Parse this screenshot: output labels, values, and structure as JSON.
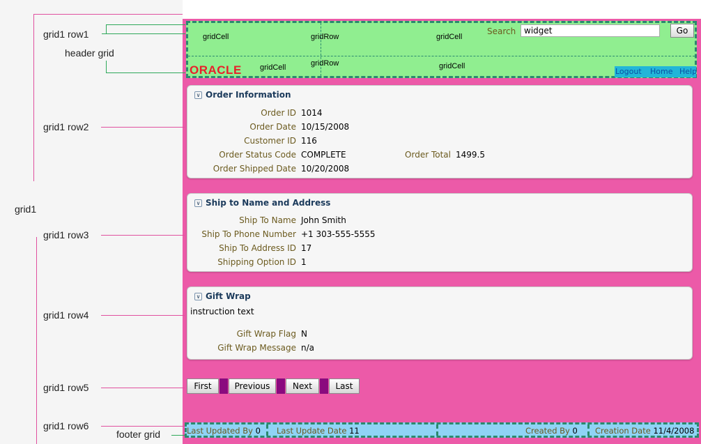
{
  "annotations": {
    "grid1_row1": "grid1 row1",
    "header_grid": "header grid",
    "grid1_row2": "grid1 row2",
    "grid1": "grid1",
    "grid1_row3": "grid1 row3",
    "grid1_row4": "grid1 row4",
    "grid1_row5": "grid1 row5",
    "grid1_row6": "grid1 row6",
    "footer_grid": "footer grid"
  },
  "header": {
    "cells": [
      "gridCell",
      "gridRow",
      "gridCell",
      "gridCell",
      "gridRow",
      "gridCell"
    ],
    "search_label": "Search",
    "search_value": "widget",
    "go_label": "Go",
    "logo": "ORACLE",
    "nav": [
      "Logout",
      "Home",
      "Help"
    ]
  },
  "order": {
    "title": "Order Information",
    "labels": [
      "Order ID",
      "Order Date",
      "Customer ID",
      "Order Status Code",
      "Order Shipped Date"
    ],
    "values": [
      "1014",
      "10/15/2008",
      "116",
      "COMPLETE",
      "10/20/2008"
    ],
    "total_label": "Order Total",
    "total_value": "1499.5"
  },
  "ship": {
    "title": "Ship to Name and Address",
    "labels": [
      "Ship To Name",
      "Ship To Phone Number",
      "Ship To Address ID",
      "Shipping Option ID"
    ],
    "values": [
      "John Smith",
      "+1 303-555-5555",
      "17",
      "1"
    ]
  },
  "gift": {
    "title": "Gift Wrap",
    "instruction": "instruction text",
    "labels": [
      "Gift Wrap Flag",
      "Gift Wrap Message"
    ],
    "values": [
      "N",
      "n/a"
    ]
  },
  "pager": {
    "first": "First",
    "previous": "Previous",
    "next": "Next",
    "last": "Last"
  },
  "footer": {
    "updated_by_label": "Last Updated By",
    "updated_by_value": "0",
    "update_date_label": "Last Update Date",
    "update_date_value": "11",
    "created_by_label": "Created By",
    "created_by_value": "0",
    "creation_date_label": "Creation Date",
    "creation_date_value": "11/4/2008"
  },
  "colors": {
    "pink": "#ec5aa8",
    "header_green": "#90ee90",
    "footer_blue": "#8fd3f5",
    "dash_green": "#2b8a6f",
    "label_olive": "#6b5a1e",
    "button_spacer": "#8a0a7e"
  }
}
